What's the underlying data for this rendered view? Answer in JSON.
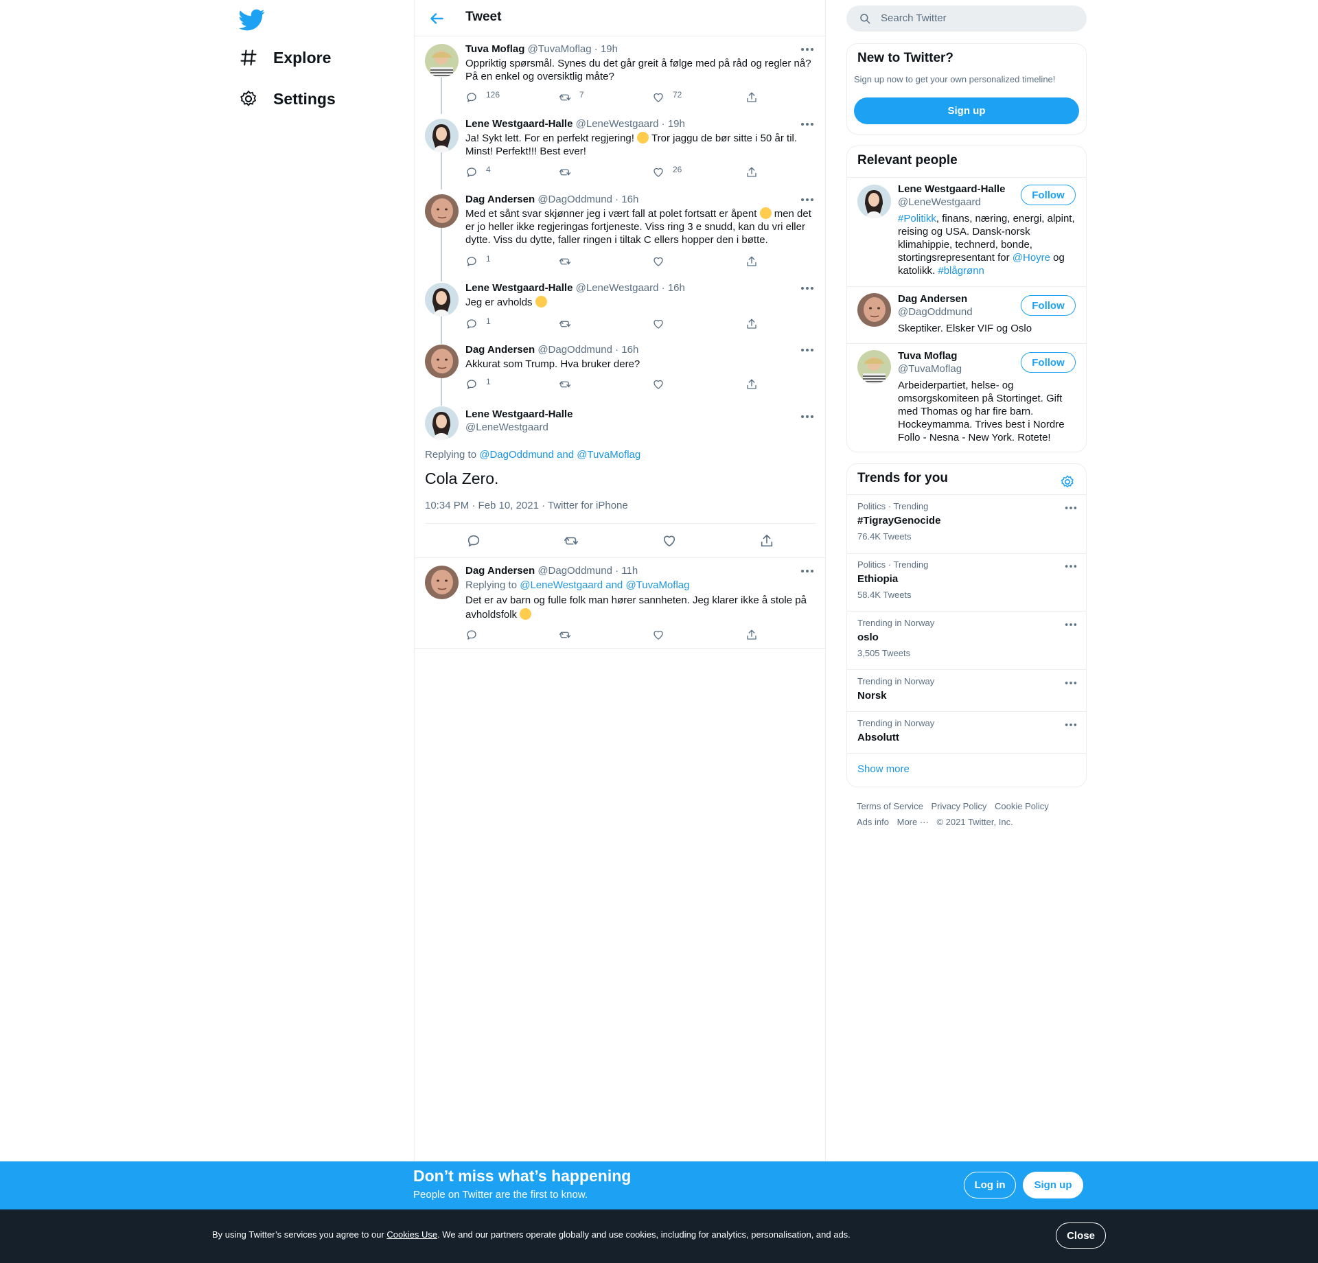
{
  "nav": {
    "explore_label": "Explore",
    "settings_label": "Settings"
  },
  "header": {
    "title": "Tweet"
  },
  "thread": [
    {
      "name": "Tuva Moflag",
      "handle": "@TuvaMoflag",
      "time": "· 19h",
      "text": "Oppriktig spørsmål. Synes du det går greit å følge med på råd og regler nå? På en enkel og oversiktlig måte?",
      "replies": "126",
      "retweets": "7",
      "likes": "72"
    },
    {
      "name": "Lene Westgaard-Halle",
      "handle": "@LeneWestgaard",
      "time": "· 19h",
      "text_a": "Ja! Sykt lett. For en perfekt regjering! ",
      "text_b": " Tror jaggu de bør sitte i 50 år til. Minst! Perfekt!!! Best ever!",
      "replies": "4",
      "retweets": "",
      "likes": "26"
    },
    {
      "name": "Dag Andersen",
      "handle": "@DagOddmund",
      "time": "· 16h",
      "text_a": "Med et sånt svar skjønner jeg i vært fall at polet fortsatt er åpent ",
      "text_b": " men det er jo heller ikke regjeringas fortjeneste. Viss ring 3 e snudd, kan du vri eller dytte. Viss du dytte, faller ringen i tiltak C ellers hopper den i bøtte.",
      "replies": "1",
      "retweets": "",
      "likes": ""
    },
    {
      "name": "Lene Westgaard-Halle",
      "handle": "@LeneWestgaard",
      "time": "· 16h",
      "text_a": "Jeg er avholds ",
      "replies": "1",
      "retweets": "",
      "likes": ""
    },
    {
      "name": "Dag Andersen",
      "handle": "@DagOddmund",
      "time": "· 16h",
      "text": "Akkurat som Trump. Hva bruker dere?",
      "replies": "1",
      "retweets": "",
      "likes": ""
    }
  ],
  "focus": {
    "name": "Lene Westgaard-Halle",
    "handle": "@LeneWestgaard",
    "replying_prefix": "Replying to ",
    "replying_to": "@DagOddmund and @TuvaMoflag",
    "text": "Cola Zero.",
    "time": "10:34 PM · Feb 10, 2021",
    "source": "· Twitter for iPhone"
  },
  "reply": {
    "name": "Dag Andersen",
    "handle": "@DagOddmund",
    "time": "· 11h",
    "replying_prefix": "Replying to ",
    "replying_to": "@LeneWestgaard and @TuvaMoflag",
    "text_a": "Det er av barn og fulle folk man hører sannheten. Jeg klarer ikke å stole på avholdsfolk "
  },
  "search": {
    "placeholder": "Search Twitter"
  },
  "new_to_twitter": {
    "title": "New to Twitter?",
    "subtitle": "Sign up now to get your own personalized timeline!",
    "button": "Sign up"
  },
  "relevant": {
    "title": "Relevant people",
    "follow_label": "Follow",
    "people": [
      {
        "name": "Lene Westgaard-Halle",
        "handle": "@LeneWestgaard",
        "bio_tag1": "#Politikk",
        "bio_a": ", finans, næring, energi, alpint, reising og USA. Dansk-norsk klimahippie, technerd, bonde, stortingsrepresentant for ",
        "bio_tag2": "@Hoyre",
        "bio_b": " og katolikk. ",
        "bio_tag3": "#blågrønn"
      },
      {
        "name": "Dag Andersen",
        "handle": "@DagOddmund",
        "bio": "Skeptiker. Elsker VIF og Oslo"
      },
      {
        "name": "Tuva Moflag",
        "handle": "@TuvaMoflag",
        "bio": "Arbeiderpartiet, helse- og omsorgskomiteen på Stortinget. Gift med Thomas og har fire barn. Hockeymamma. Trives best i Nordre Follo - Nesna - New York. Rotete!"
      }
    ]
  },
  "trends": {
    "title": "Trends for you",
    "items": [
      {
        "context": "Politics · Trending",
        "name": "#TigrayGenocide",
        "count": "76.4K Tweets"
      },
      {
        "context": "Politics · Trending",
        "name": "Ethiopia",
        "count": "58.4K Tweets"
      },
      {
        "context": "Trending in Norway",
        "name": "oslo",
        "count": "3,505 Tweets"
      },
      {
        "context": "Trending in Norway",
        "name": "Norsk",
        "count": ""
      },
      {
        "context": "Trending in Norway",
        "name": "Absolutt",
        "count": ""
      }
    ],
    "show_more": "Show more"
  },
  "footer": {
    "terms": "Terms of Service",
    "privacy": "Privacy Policy",
    "cookie": "Cookie Policy",
    "ads": "Ads info",
    "more": "More ···",
    "copyright": "© 2021 Twitter, Inc."
  },
  "banner": {
    "title": "Don’t miss what’s happening",
    "subtitle": "People on Twitter are the first to know.",
    "login": "Log in",
    "signup": "Sign up"
  },
  "cookie_bar": {
    "text_a": "By using Twitter’s services you agree to our ",
    "link": "Cookies Use",
    "text_b": ". We and our partners operate globally and use cookies, including for analytics, personalisation, and ads.",
    "close": "Close"
  },
  "colors": {
    "accent": "#1da1f2",
    "link": "#1b95e0",
    "muted": "#5b7083",
    "cookie_bg": "#15202b"
  }
}
